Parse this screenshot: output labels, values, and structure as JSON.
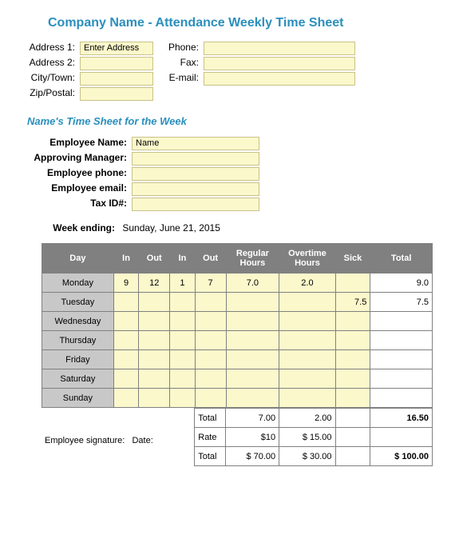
{
  "title": "Company Name - Attendance Weekly Time Sheet",
  "company": {
    "address1_label": "Address 1:",
    "address1_value": "Enter Address",
    "address2_label": "Address 2:",
    "address2_value": "",
    "city_label": "City/Town:",
    "city_value": "",
    "zip_label": "Zip/Postal:",
    "zip_value": "",
    "phone_label": "Phone:",
    "phone_value": "",
    "fax_label": "Fax:",
    "fax_value": "",
    "email_label": "E-mail:",
    "email_value": ""
  },
  "subhead": "Name's Time Sheet for the Week",
  "employee": {
    "name_label": "Employee Name:",
    "name_value": "Name",
    "manager_label": "Approving Manager:",
    "manager_value": "",
    "phone_label": "Employee phone:",
    "phone_value": "",
    "email_label": "Employee email:",
    "email_value": "",
    "tax_label": "Tax ID#:",
    "tax_value": ""
  },
  "week_ending_label": "Week ending:",
  "week_ending_value": "Sunday, June 21, 2015",
  "headers": {
    "day": "Day",
    "in1": "In",
    "out1": "Out",
    "in2": "In",
    "out2": "Out",
    "regular": "Regular Hours",
    "overtime": "Overtime Hours",
    "sick": "Sick",
    "total": "Total"
  },
  "rows": [
    {
      "day": "Monday",
      "in1": "9",
      "out1": "12",
      "in2": "1",
      "out2": "7",
      "reg": "7.0",
      "ot": "2.0",
      "sick": "",
      "total": "9.0"
    },
    {
      "day": "Tuesday",
      "in1": "",
      "out1": "",
      "in2": "",
      "out2": "",
      "reg": "",
      "ot": "",
      "sick": "7.5",
      "total": "7.5"
    },
    {
      "day": "Wednesday",
      "in1": "",
      "out1": "",
      "in2": "",
      "out2": "",
      "reg": "",
      "ot": "",
      "sick": "",
      "total": ""
    },
    {
      "day": "Thursday",
      "in1": "",
      "out1": "",
      "in2": "",
      "out2": "",
      "reg": "",
      "ot": "",
      "sick": "",
      "total": ""
    },
    {
      "day": "Friday",
      "in1": "",
      "out1": "",
      "in2": "",
      "out2": "",
      "reg": "",
      "ot": "",
      "sick": "",
      "total": ""
    },
    {
      "day": "Saturday",
      "in1": "",
      "out1": "",
      "in2": "",
      "out2": "",
      "reg": "",
      "ot": "",
      "sick": "",
      "total": ""
    },
    {
      "day": "Sunday",
      "in1": "",
      "out1": "",
      "in2": "",
      "out2": "",
      "reg": "",
      "ot": "",
      "sick": "",
      "total": ""
    }
  ],
  "summary": {
    "total_label": "Total",
    "total_reg": "7.00",
    "total_ot": "2.00",
    "total_all": "16.50",
    "rate_label": "Rate",
    "rate_reg": "$10",
    "rate_ot": "$    15.00",
    "grand_label": "Total",
    "grand_reg": "$  70.00",
    "grand_ot": "$    30.00",
    "grand_all": "$  100.00"
  },
  "signature_label": "Employee signature:",
  "date_label": "Date:",
  "chart_data": {
    "type": "table",
    "columns": [
      "Day",
      "In",
      "Out",
      "In",
      "Out",
      "Regular Hours",
      "Overtime Hours",
      "Sick",
      "Total"
    ],
    "rows": [
      [
        "Monday",
        9,
        12,
        1,
        7,
        7.0,
        2.0,
        null,
        9.0
      ],
      [
        "Tuesday",
        null,
        null,
        null,
        null,
        null,
        null,
        7.5,
        7.5
      ],
      [
        "Wednesday",
        null,
        null,
        null,
        null,
        null,
        null,
        null,
        null
      ],
      [
        "Thursday",
        null,
        null,
        null,
        null,
        null,
        null,
        null,
        null
      ],
      [
        "Friday",
        null,
        null,
        null,
        null,
        null,
        null,
        null,
        null
      ],
      [
        "Saturday",
        null,
        null,
        null,
        null,
        null,
        null,
        null,
        null
      ],
      [
        "Sunday",
        null,
        null,
        null,
        null,
        null,
        null,
        null,
        null
      ]
    ],
    "totals": {
      "regular": 7.0,
      "overtime": 2.0,
      "all": 16.5
    },
    "rates": {
      "regular": 10,
      "overtime": 15.0
    },
    "amounts": {
      "regular": 70.0,
      "overtime": 30.0,
      "grand": 100.0
    }
  }
}
